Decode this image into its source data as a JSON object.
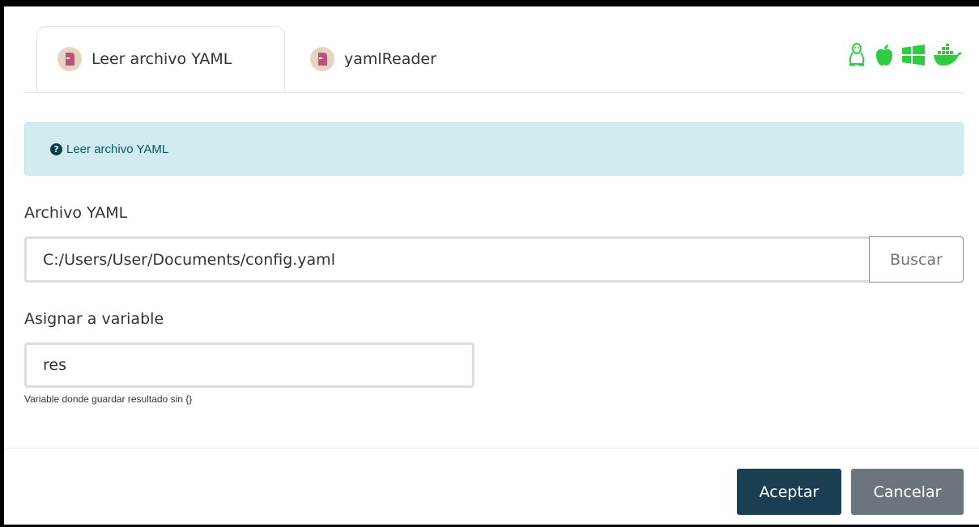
{
  "tabs": [
    {
      "label": "Leer archivo YAML",
      "active": true,
      "icon": "module-icon"
    },
    {
      "label": "yamlReader",
      "active": false,
      "icon": "module-icon"
    }
  ],
  "os_icons": [
    "linux-icon",
    "apple-icon",
    "windows-icon",
    "docker-icon"
  ],
  "colors": {
    "os_icon": "#2ecc40",
    "alert_bg": "#d1ecf1",
    "primary": "#1b3f52",
    "secondary": "#6c757d"
  },
  "alert": {
    "text": "Leer archivo YAML"
  },
  "yaml_file": {
    "label": "Archivo YAML",
    "value": "C:/Users/User/Documents/config.yaml",
    "browse_label": "Buscar"
  },
  "variable": {
    "label": "Asignar a variable",
    "value": "res",
    "help": "Variable donde guardar resultado sin {}"
  },
  "footer": {
    "accept_label": "Aceptar",
    "cancel_label": "Cancelar"
  }
}
